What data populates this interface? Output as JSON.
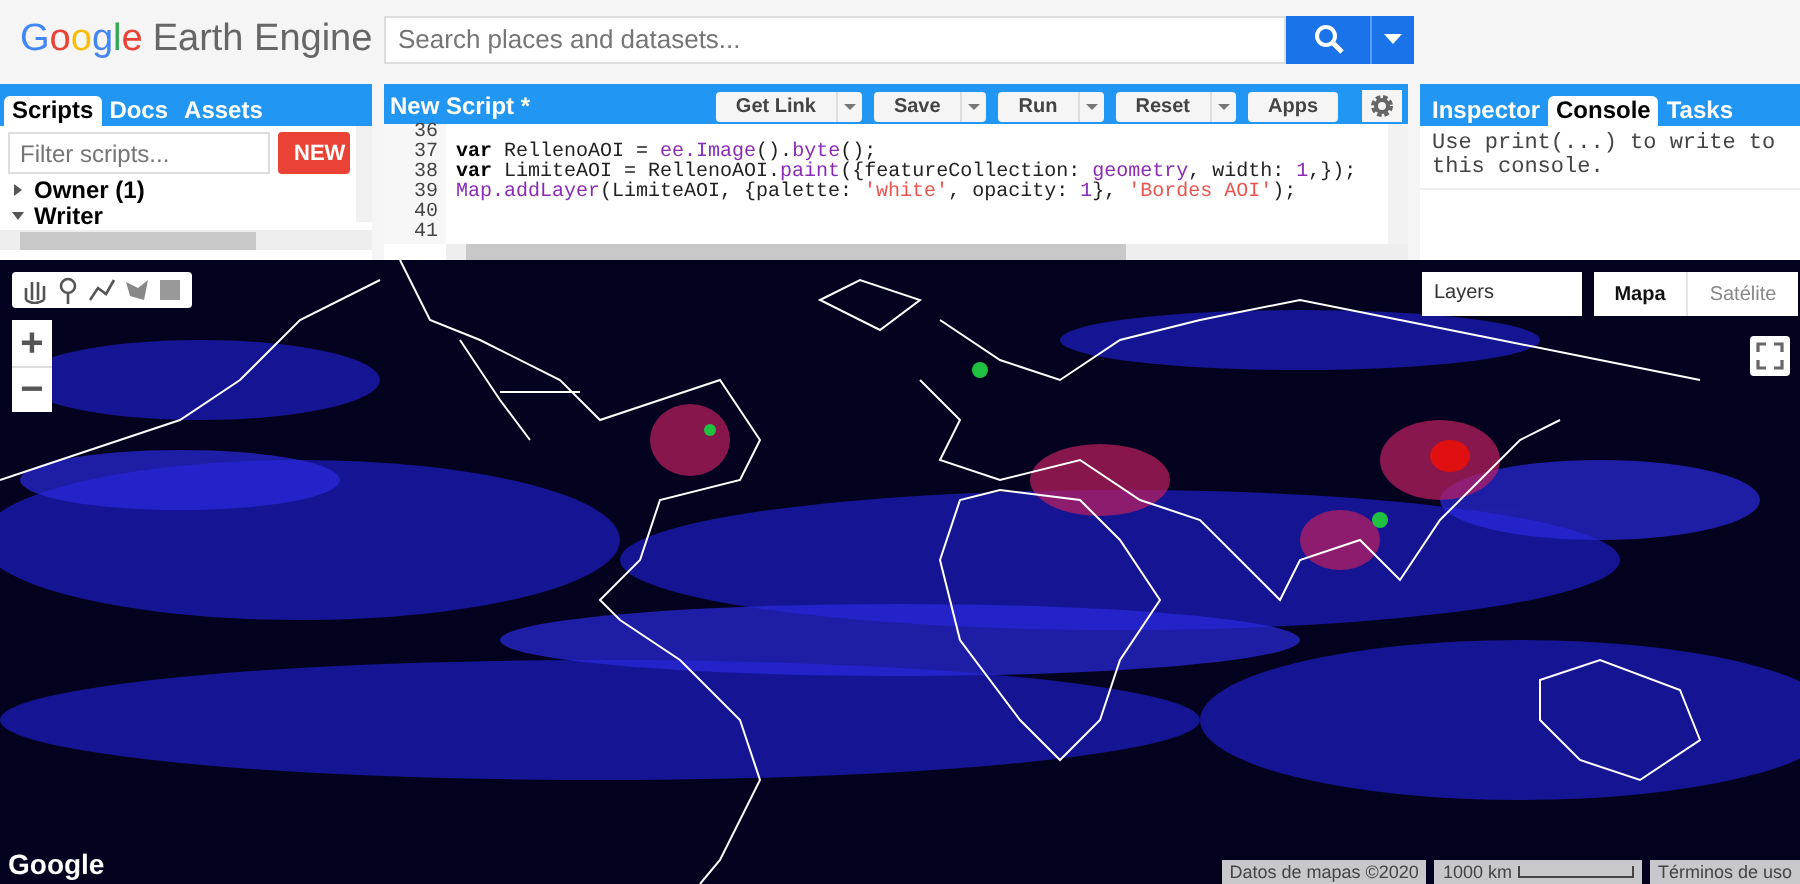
{
  "header": {
    "logo_brand": "Google",
    "logo_product": "Earth Engine",
    "search": {
      "placeholder": "Search places and datasets..."
    }
  },
  "left_panel": {
    "tabs": [
      {
        "label": "Scripts",
        "selected": true
      },
      {
        "label": "Docs",
        "selected": false
      },
      {
        "label": "Assets",
        "selected": false
      }
    ],
    "filter": {
      "placeholder": "Filter scripts..."
    },
    "new_button": "NEW",
    "tree": [
      {
        "label": "Owner (1)",
        "expanded": false
      },
      {
        "label": "Writer",
        "expanded": true
      }
    ]
  },
  "editor": {
    "title": "New Script *",
    "buttons": [
      {
        "label": "Get Link",
        "has_menu": true
      },
      {
        "label": "Save",
        "has_menu": true
      },
      {
        "label": "Run",
        "has_menu": true
      },
      {
        "label": "Reset",
        "has_menu": true
      },
      {
        "label": "Apps",
        "has_menu": false
      }
    ],
    "lines": [
      {
        "number": "36"
      },
      {
        "number": "37",
        "tokens": [
          {
            "kind": "keyword",
            "text": "var"
          },
          {
            "kind": "plain",
            "text": " RellenoAOI = "
          },
          {
            "kind": "call",
            "text": "ee.Image"
          },
          {
            "kind": "plain",
            "text": "()."
          },
          {
            "kind": "call",
            "text": "byte"
          },
          {
            "kind": "plain",
            "text": "();"
          }
        ]
      },
      {
        "number": "38",
        "tokens": [
          {
            "kind": "keyword",
            "text": "var"
          },
          {
            "kind": "plain",
            "text": " LimiteAOI = RellenoAOI."
          },
          {
            "kind": "call",
            "text": "paint"
          },
          {
            "kind": "plain",
            "text": "({featureCollection: "
          },
          {
            "kind": "call",
            "text": "geometry"
          },
          {
            "kind": "plain",
            "text": ", width: "
          },
          {
            "kind": "call",
            "text": "1"
          },
          {
            "kind": "plain",
            "text": ",});"
          }
        ]
      },
      {
        "number": "39",
        "tokens": [
          {
            "kind": "call",
            "text": "Map.addLayer"
          },
          {
            "kind": "plain",
            "text": "(LimiteAOI, {palette: "
          },
          {
            "kind": "string",
            "text": "'white'"
          },
          {
            "kind": "plain",
            "text": ", opacity: "
          },
          {
            "kind": "call",
            "text": "1"
          },
          {
            "kind": "plain",
            "text": "}, "
          },
          {
            "kind": "string",
            "text": "'Bordes AOI'"
          },
          {
            "kind": "plain",
            "text": ");"
          }
        ]
      },
      {
        "number": "40"
      },
      {
        "number": "41"
      }
    ]
  },
  "right_panel": {
    "tabs": [
      {
        "label": "Inspector",
        "selected": false
      },
      {
        "label": "Console",
        "selected": true
      },
      {
        "label": "Tasks",
        "selected": false
      }
    ],
    "console_text": "Use print(...) to write to this console."
  },
  "map": {
    "layers_label": "Layers",
    "map_types": [
      {
        "label": "Mapa",
        "selected": true
      },
      {
        "label": "Satélite",
        "selected": false
      }
    ],
    "zoom_in": "+",
    "zoom_out": "−",
    "logo": "Google",
    "attribution": "Datos de mapas ©2020",
    "scale_label": "1000 km",
    "terms": "Términos de uso"
  }
}
